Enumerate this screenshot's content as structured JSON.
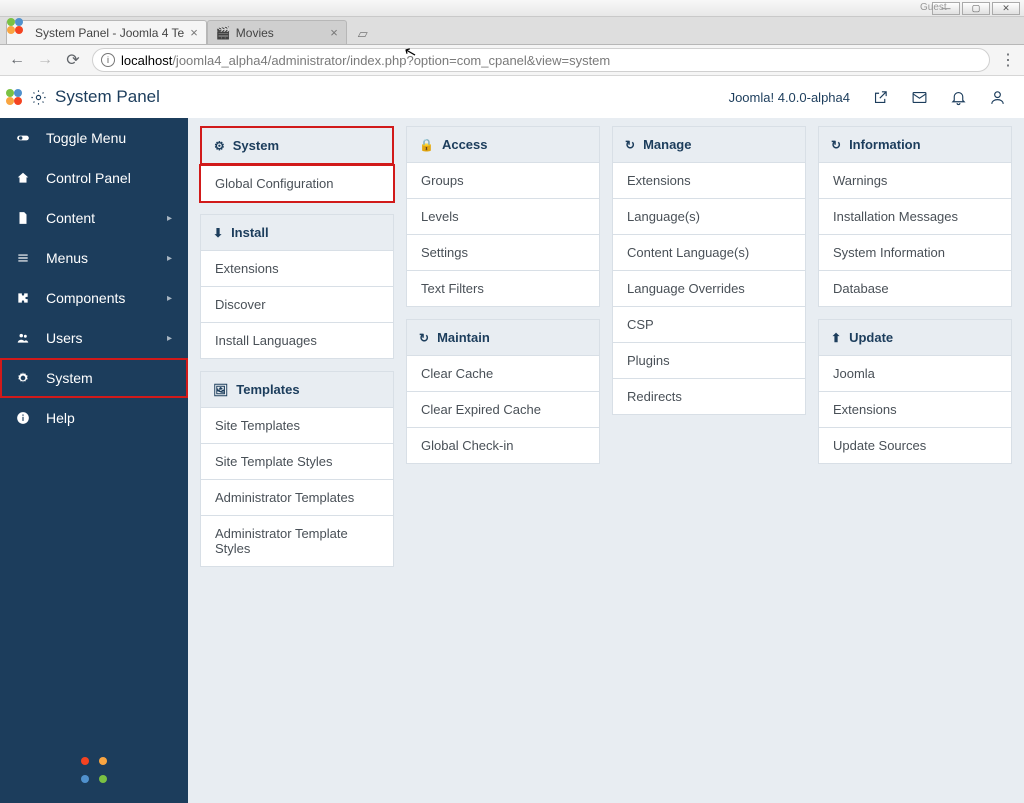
{
  "os": {
    "guest": "Guest"
  },
  "tabs": [
    {
      "title": "System Panel - Joomla 4 Te",
      "active": true
    },
    {
      "title": "Movies",
      "active": false
    }
  ],
  "address": {
    "host": "localhost",
    "path": "/joomla4_alpha4/administrator/index.php?option=com_cpanel&view=system"
  },
  "topbar": {
    "title": "System Panel",
    "version": "Joomla! 4.0.0-alpha4"
  },
  "sidebar": [
    {
      "label": "Toggle Menu",
      "icon": "toggle",
      "sub": false
    },
    {
      "label": "Control Panel",
      "icon": "home",
      "sub": false
    },
    {
      "label": "Content",
      "icon": "file",
      "sub": true
    },
    {
      "label": "Menus",
      "icon": "list",
      "sub": true
    },
    {
      "label": "Components",
      "icon": "puzzle",
      "sub": true
    },
    {
      "label": "Users",
      "icon": "users",
      "sub": true
    },
    {
      "label": "System",
      "icon": "gear",
      "sub": false,
      "highlight": true
    },
    {
      "label": "Help",
      "icon": "info",
      "sub": false
    }
  ],
  "columns": [
    [
      {
        "title": "System",
        "icon": "gear",
        "highlight": true,
        "items": [
          {
            "label": "Global Configuration",
            "highlight": true
          }
        ]
      },
      {
        "title": "Install",
        "icon": "download",
        "items": [
          {
            "label": "Extensions"
          },
          {
            "label": "Discover"
          },
          {
            "label": "Install Languages"
          }
        ]
      },
      {
        "title": "Templates",
        "icon": "image",
        "items": [
          {
            "label": "Site Templates"
          },
          {
            "label": "Site Template Styles"
          },
          {
            "label": "Administrator Templates"
          },
          {
            "label": "Administrator Template Styles"
          }
        ]
      }
    ],
    [
      {
        "title": "Access",
        "icon": "lock",
        "items": [
          {
            "label": "Groups"
          },
          {
            "label": "Levels"
          },
          {
            "label": "Settings"
          },
          {
            "label": "Text Filters"
          }
        ]
      },
      {
        "title": "Maintain",
        "icon": "refresh",
        "items": [
          {
            "label": "Clear Cache"
          },
          {
            "label": "Clear Expired Cache"
          },
          {
            "label": "Global Check-in"
          }
        ]
      }
    ],
    [
      {
        "title": "Manage",
        "icon": "refresh",
        "items": [
          {
            "label": "Extensions"
          },
          {
            "label": "Language(s)"
          },
          {
            "label": "Content Language(s)"
          },
          {
            "label": "Language Overrides"
          },
          {
            "label": "CSP"
          },
          {
            "label": "Plugins"
          },
          {
            "label": "Redirects"
          }
        ]
      }
    ],
    [
      {
        "title": "Information",
        "icon": "refresh",
        "items": [
          {
            "label": "Warnings"
          },
          {
            "label": "Installation Messages"
          },
          {
            "label": "System Information"
          },
          {
            "label": "Database"
          }
        ]
      },
      {
        "title": "Update",
        "icon": "upload",
        "items": [
          {
            "label": "Joomla"
          },
          {
            "label": "Extensions"
          },
          {
            "label": "Update Sources"
          }
        ]
      }
    ]
  ]
}
